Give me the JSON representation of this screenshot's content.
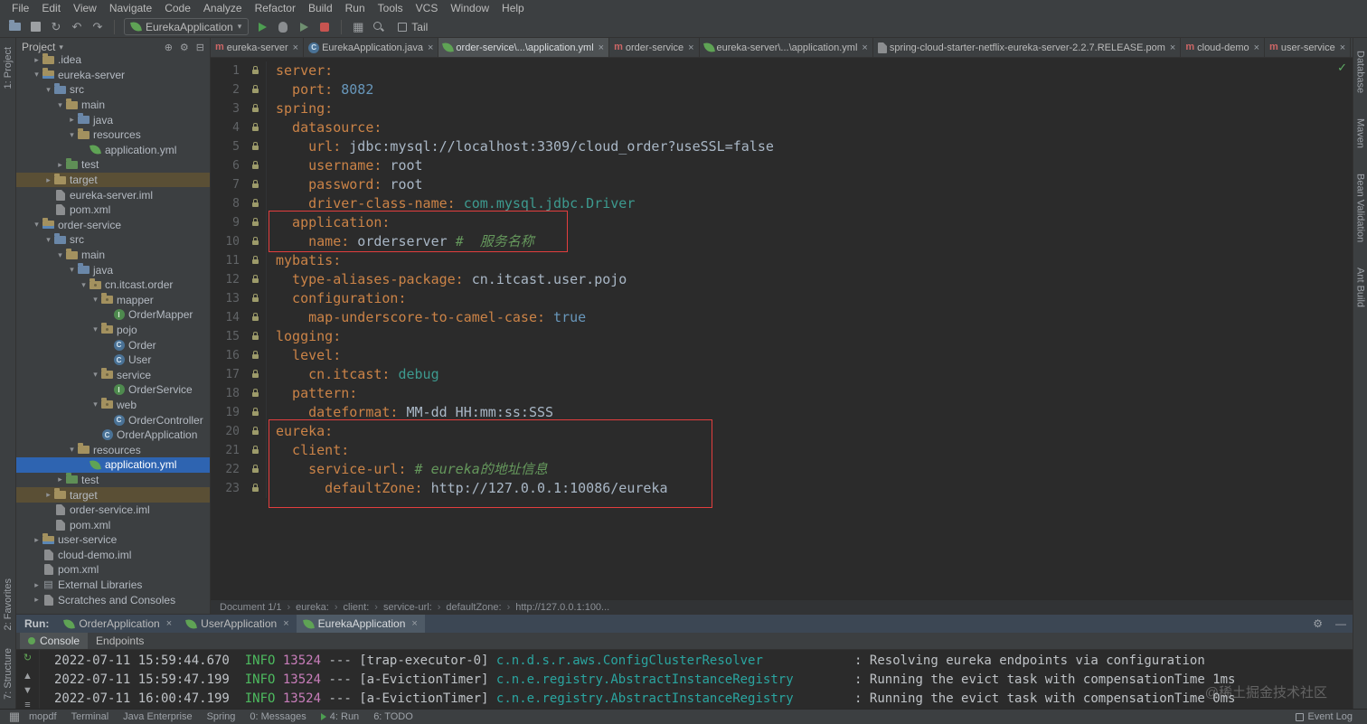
{
  "menu": [
    "File",
    "Edit",
    "View",
    "Navigate",
    "Code",
    "Analyze",
    "Refactor",
    "Build",
    "Run",
    "Tools",
    "VCS",
    "Window",
    "Help"
  ],
  "toolbar": {
    "run_config": "EurekaApplication",
    "tail_label": "Tail"
  },
  "left_strip": {
    "top": [
      "1: Project"
    ],
    "bottom": [
      "2: Favorites",
      "7: Structure"
    ]
  },
  "right_strip": [
    "Database",
    "Maven",
    "Bean Validation",
    "Ant Build"
  ],
  "project": {
    "header": "Project",
    "tree": [
      {
        "level": 1,
        "arrow": "right",
        "icon": "folder",
        "label": ".idea"
      },
      {
        "level": 1,
        "arrow": "down",
        "icon": "mod",
        "label": "eureka-server"
      },
      {
        "level": 2,
        "arrow": "down",
        "icon": "src",
        "label": "src"
      },
      {
        "level": 3,
        "arrow": "down",
        "icon": "folder",
        "label": "main"
      },
      {
        "level": 4,
        "arrow": "right",
        "icon": "src",
        "label": "java"
      },
      {
        "level": 4,
        "arrow": "down",
        "icon": "folder",
        "label": "resources"
      },
      {
        "level": 5,
        "arrow": "",
        "icon": "leaf",
        "label": "application.yml"
      },
      {
        "level": 3,
        "arrow": "right",
        "icon": "grn",
        "label": "test"
      },
      {
        "level": 2,
        "arrow": "right",
        "icon": "folder",
        "label": "target",
        "excluded": true
      },
      {
        "level": 2,
        "arrow": "",
        "icon": "file",
        "label": "eureka-server.iml"
      },
      {
        "level": 2,
        "arrow": "",
        "icon": "file",
        "label": "pom.xml"
      },
      {
        "level": 1,
        "arrow": "down",
        "icon": "mod",
        "label": "order-service"
      },
      {
        "level": 2,
        "arrow": "down",
        "icon": "src",
        "label": "src"
      },
      {
        "level": 3,
        "arrow": "down",
        "icon": "folder",
        "label": "main"
      },
      {
        "level": 4,
        "arrow": "down",
        "icon": "src",
        "label": "java"
      },
      {
        "level": 5,
        "arrow": "down",
        "icon": "pkg",
        "label": "cn.itcast.order"
      },
      {
        "level": 6,
        "arrow": "down",
        "icon": "pkg",
        "label": "mapper"
      },
      {
        "level": 7,
        "arrow": "",
        "icon": "iface",
        "label": "OrderMapper"
      },
      {
        "level": 6,
        "arrow": "down",
        "icon": "pkg",
        "label": "pojo"
      },
      {
        "level": 7,
        "arrow": "",
        "icon": "class",
        "label": "Order"
      },
      {
        "level": 7,
        "arrow": "",
        "icon": "class",
        "label": "User"
      },
      {
        "level": 6,
        "arrow": "down",
        "icon": "pkg",
        "label": "service"
      },
      {
        "level": 7,
        "arrow": "",
        "icon": "iface",
        "label": "OrderService"
      },
      {
        "level": 6,
        "arrow": "down",
        "icon": "pkg",
        "label": "web"
      },
      {
        "level": 7,
        "arrow": "",
        "icon": "class",
        "label": "OrderController"
      },
      {
        "level": 6,
        "arrow": "",
        "icon": "class",
        "label": "OrderApplication"
      },
      {
        "level": 4,
        "arrow": "down",
        "icon": "folder",
        "label": "resources"
      },
      {
        "level": 5,
        "arrow": "",
        "icon": "leaf",
        "label": "application.yml",
        "selected": true
      },
      {
        "level": 3,
        "arrow": "right",
        "icon": "grn",
        "label": "test"
      },
      {
        "level": 2,
        "arrow": "right",
        "icon": "folder",
        "label": "target",
        "excluded": true
      },
      {
        "level": 2,
        "arrow": "",
        "icon": "file",
        "label": "order-service.iml"
      },
      {
        "level": 2,
        "arrow": "",
        "icon": "file",
        "label": "pom.xml"
      },
      {
        "level": 1,
        "arrow": "right",
        "icon": "mod",
        "label": "user-service"
      },
      {
        "level": 1,
        "arrow": "",
        "icon": "file",
        "label": "cloud-demo.iml"
      },
      {
        "level": 1,
        "arrow": "",
        "icon": "file",
        "label": "pom.xml"
      },
      {
        "level": 1,
        "arrow": "right",
        "icon": "lib",
        "label": "External Libraries"
      },
      {
        "level": 1,
        "arrow": "right",
        "icon": "file",
        "label": "Scratches and Consoles"
      }
    ]
  },
  "tabs": [
    {
      "icon": "mvn",
      "label": "eureka-server"
    },
    {
      "icon": "class",
      "label": "EurekaApplication.java"
    },
    {
      "icon": "leaf",
      "label": "order-service\\...\\application.yml",
      "selected": true
    },
    {
      "icon": "mvn",
      "label": "order-service"
    },
    {
      "icon": "leaf",
      "label": "eureka-server\\...\\application.yml"
    },
    {
      "icon": "file",
      "label": "spring-cloud-starter-netflix-eureka-server-2.2.7.RELEASE.pom"
    },
    {
      "icon": "mvn",
      "label": "cloud-demo"
    },
    {
      "icon": "mvn",
      "label": "user-service"
    }
  ],
  "editor": {
    "lines": [
      {
        "n": 1,
        "s": [
          [
            "k",
            "server:"
          ]
        ]
      },
      {
        "n": 2,
        "s": [
          [
            "k",
            "  port:"
          ],
          [
            "n",
            " 8082"
          ]
        ]
      },
      {
        "n": 3,
        "s": [
          [
            "k",
            "spring:"
          ]
        ]
      },
      {
        "n": 4,
        "s": [
          [
            "k",
            "  datasource:"
          ]
        ]
      },
      {
        "n": 5,
        "s": [
          [
            "k",
            "    url:"
          ],
          [
            "v",
            " jdbc:mysql://localhost:3309/cloud_order?useSSL=false"
          ]
        ]
      },
      {
        "n": 6,
        "s": [
          [
            "k",
            "    username:"
          ],
          [
            "v",
            " root"
          ]
        ]
      },
      {
        "n": 7,
        "s": [
          [
            "k",
            "    password:"
          ],
          [
            "v",
            " root"
          ]
        ]
      },
      {
        "n": 8,
        "s": [
          [
            "k",
            "    driver-class-name:"
          ],
          [
            "t",
            " com.mysql.jdbc.Driver"
          ]
        ]
      },
      {
        "n": 9,
        "s": [
          [
            "k",
            "  application:"
          ]
        ]
      },
      {
        "n": 10,
        "s": [
          [
            "k",
            "    name:"
          ],
          [
            "v",
            " orderserver "
          ],
          [
            "c",
            "#  服务名称"
          ]
        ]
      },
      {
        "n": 11,
        "s": [
          [
            "k",
            "mybatis:"
          ]
        ]
      },
      {
        "n": 12,
        "s": [
          [
            "k",
            "  type-aliases-package:"
          ],
          [
            "v",
            " cn.itcast.user.pojo"
          ]
        ]
      },
      {
        "n": 13,
        "s": [
          [
            "k",
            "  configuration:"
          ]
        ]
      },
      {
        "n": 14,
        "s": [
          [
            "k",
            "    map-underscore-to-camel-case:"
          ],
          [
            "n",
            " true"
          ]
        ]
      },
      {
        "n": 15,
        "s": [
          [
            "k",
            "logging:"
          ]
        ]
      },
      {
        "n": 16,
        "s": [
          [
            "k",
            "  level:"
          ]
        ]
      },
      {
        "n": 17,
        "s": [
          [
            "k",
            "    cn.itcast:"
          ],
          [
            "t",
            " debug"
          ]
        ]
      },
      {
        "n": 18,
        "s": [
          [
            "k",
            "  pattern:"
          ]
        ]
      },
      {
        "n": 19,
        "s": [
          [
            "k",
            "    dateformat:"
          ],
          [
            "v",
            " MM-dd HH:mm:ss:SSS"
          ]
        ]
      },
      {
        "n": 20,
        "s": [
          [
            "k",
            "eureka:"
          ]
        ]
      },
      {
        "n": 21,
        "s": [
          [
            "k",
            "  client:"
          ]
        ]
      },
      {
        "n": 22,
        "s": [
          [
            "k",
            "    service-url:"
          ],
          [
            "c",
            " # eureka的地址信息"
          ]
        ]
      },
      {
        "n": 23,
        "s": [
          [
            "k",
            "      defaultZone:"
          ],
          [
            "v",
            " http://127.0.0.1:10086/eureka"
          ]
        ]
      }
    ]
  },
  "breadcrumb": [
    "Document 1/1",
    "eureka:",
    "client:",
    "service-url:",
    "defaultZone:",
    "http://127.0.0.1:100..."
  ],
  "run_panel": {
    "label": "Run:",
    "tabs": [
      {
        "label": "OrderApplication"
      },
      {
        "label": "UserApplication"
      },
      {
        "label": "EurekaApplication",
        "selected": true
      }
    ],
    "views": [
      "Console",
      "Endpoints"
    ]
  },
  "console": {
    "lines": [
      {
        "ts": "2022-07-11 15:59:44.670",
        "level": "INFO",
        "pid": "13524",
        "thread": "[trap-executor-0]",
        "logger": "c.n.d.s.r.aws.ConfigClusterResolver",
        "msg": "Resolving eureka endpoints via configuration"
      },
      {
        "ts": "2022-07-11 15:59:47.199",
        "level": "INFO",
        "pid": "13524",
        "thread": "[a-EvictionTimer]",
        "logger": "c.n.e.registry.AbstractInstanceRegistry",
        "msg": "Running the evict task with compensationTime 1ms"
      },
      {
        "ts": "2022-07-11 16:00:47.199",
        "level": "INFO",
        "pid": "13524",
        "thread": "[a-EvictionTimer]",
        "logger": "c.n.e.registry.AbstractInstanceRegistry",
        "msg": "Running the evict task with compensationTime 0ms"
      }
    ]
  },
  "status_bar": {
    "left": [
      {
        "label": "mopdf"
      },
      {
        "label": "Terminal"
      },
      {
        "label": "Java Enterprise"
      },
      {
        "label": "Spring"
      },
      {
        "label": "0: Messages"
      },
      {
        "label": "4: Run",
        "icon": "run"
      },
      {
        "label": "6: TODO"
      }
    ],
    "right": [
      {
        "label": "Event Log"
      }
    ]
  },
  "watermark": "@稀土掘金技术社区"
}
